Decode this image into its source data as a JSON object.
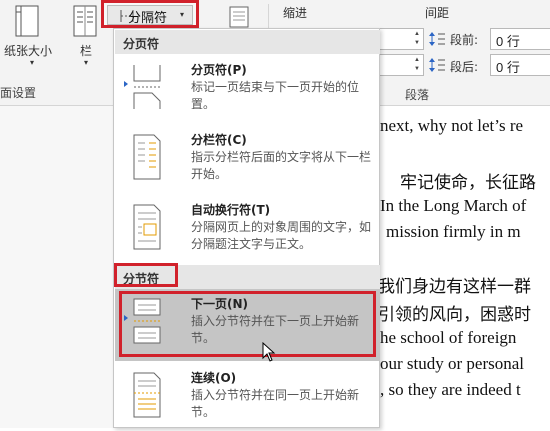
{
  "ribbon": {
    "paper_size_label": "纸张大小",
    "columns_label": "栏",
    "page_setup_label": "面设置",
    "separator_button_label": "分隔符",
    "indent_header": "缩进",
    "spacing_header": "间距",
    "before_label": "段前:",
    "after_label": "段后:",
    "before_value": "0 行",
    "after_value": "0 行",
    "paragraph_label": "段落"
  },
  "menu": {
    "section_page_breaks": "分页符",
    "section_section_breaks": "分节符",
    "items": [
      {
        "title": "分页符(P)",
        "desc": "标记一页结束与下一页开始的位置。"
      },
      {
        "title": "分栏符(C)",
        "desc": "指示分栏符后面的文字将从下一栏开始。"
      },
      {
        "title": "自动换行符(T)",
        "desc": "分隔网页上的对象周围的文字，如分隔题注文字与正文。"
      },
      {
        "title": "下一页(N)",
        "desc": "插入分节符并在下一页上开始新节。"
      },
      {
        "title": "连续(O)",
        "desc": "插入分节符并在同一页上开始新节。"
      }
    ]
  },
  "document": {
    "lines": [
      "next, why not let’s re",
      "牢记使命，长征路",
      "In the Long March of",
      "mission firmly in m",
      "我们身边有这样一群",
      "引领的风向，困惑时",
      "he school of foreign",
      "our study or personal",
      ", so they are indeed t"
    ]
  },
  "colors": {
    "highlight_red": "#d1212b",
    "menu_section_bg": "#e6e6e6",
    "selected_item_bg": "#c5c5c5",
    "ribbon_bg": "#f3f3f3"
  }
}
